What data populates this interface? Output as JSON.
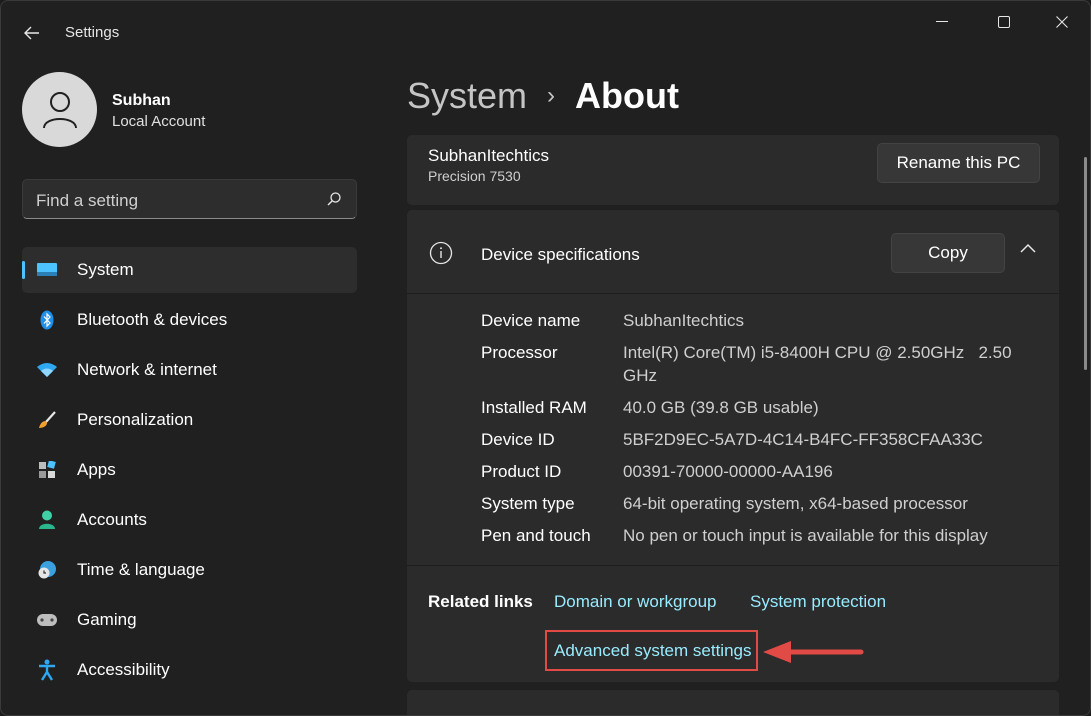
{
  "window": {
    "title": "Settings",
    "controls": [
      "minimize",
      "maximize",
      "close"
    ]
  },
  "user": {
    "name": "Subhan",
    "account_type": "Local Account"
  },
  "search": {
    "placeholder": "Find a setting"
  },
  "nav": {
    "items": [
      {
        "label": "System",
        "icon": "system-icon",
        "active": true
      },
      {
        "label": "Bluetooth & devices",
        "icon": "bluetooth-icon"
      },
      {
        "label": "Network & internet",
        "icon": "wifi-icon"
      },
      {
        "label": "Personalization",
        "icon": "brush-icon"
      },
      {
        "label": "Apps",
        "icon": "apps-icon"
      },
      {
        "label": "Accounts",
        "icon": "accounts-icon"
      },
      {
        "label": "Time & language",
        "icon": "globe-clock-icon"
      },
      {
        "label": "Gaming",
        "icon": "gamepad-icon"
      },
      {
        "label": "Accessibility",
        "icon": "accessibility-icon"
      }
    ]
  },
  "breadcrumb": {
    "parent": "System",
    "separator": "›",
    "current": "About"
  },
  "pc": {
    "name": "SubhanItechtics",
    "model": "Precision 7530",
    "rename_label": "Rename this PC"
  },
  "specs": {
    "title": "Device specifications",
    "copy_label": "Copy",
    "rows": [
      {
        "key": "Device name",
        "value": "SubhanItechtics"
      },
      {
        "key": "Processor",
        "value": "Intel(R) Core(TM) i5-8400H CPU @ 2.50GHz   2.50 GHz"
      },
      {
        "key": "Installed RAM",
        "value": "40.0 GB (39.8 GB usable)"
      },
      {
        "key": "Device ID",
        "value": "5BF2D9EC-5A7D-4C14-B4FC-FF358CFAA33C"
      },
      {
        "key": "Product ID",
        "value": "00391-70000-00000-AA196"
      },
      {
        "key": "System type",
        "value": "64-bit operating system, x64-based processor"
      },
      {
        "key": "Pen and touch",
        "value": "No pen or touch input is available for this display"
      }
    ]
  },
  "related": {
    "label": "Related links",
    "links": [
      "Domain or workgroup",
      "System protection",
      "Advanced system settings"
    ]
  },
  "colors": {
    "accent": "#4cc2ff",
    "link": "#99ebff",
    "annotation": "#e24a46"
  }
}
